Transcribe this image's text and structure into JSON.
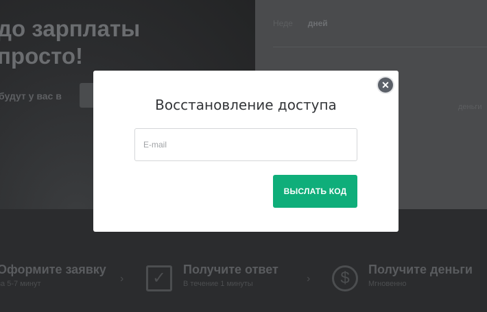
{
  "background": {
    "hero_title_line1": "до зарплаты",
    "hero_title_line2": "просто!",
    "hero_subtitle": "будут у вас в",
    "tabs": [
      "Неде",
      "дней"
    ],
    "panel_label": "деньги",
    "steps": [
      {
        "title": "Оформите заявку",
        "subtitle": "за 5-7 минут"
      },
      {
        "title": "Получите ответ",
        "subtitle": "В течение 1 минуты"
      },
      {
        "title": "Получите деньги",
        "subtitle": "Мгновенно"
      }
    ]
  },
  "modal": {
    "title": "Восстановление доступа",
    "close_symbol": "✕",
    "email_placeholder": "E-mail",
    "email_value": "",
    "send_button_label": "ВЫСЛАТЬ КОД"
  },
  "colors": {
    "accent": "#0fae7a",
    "close_button": "#5b6068",
    "dimmed_background": "#2a2b2c"
  },
  "icons": {
    "close": "close-icon",
    "step2": "checkbox-icon",
    "step3": "money-bag-icon"
  }
}
